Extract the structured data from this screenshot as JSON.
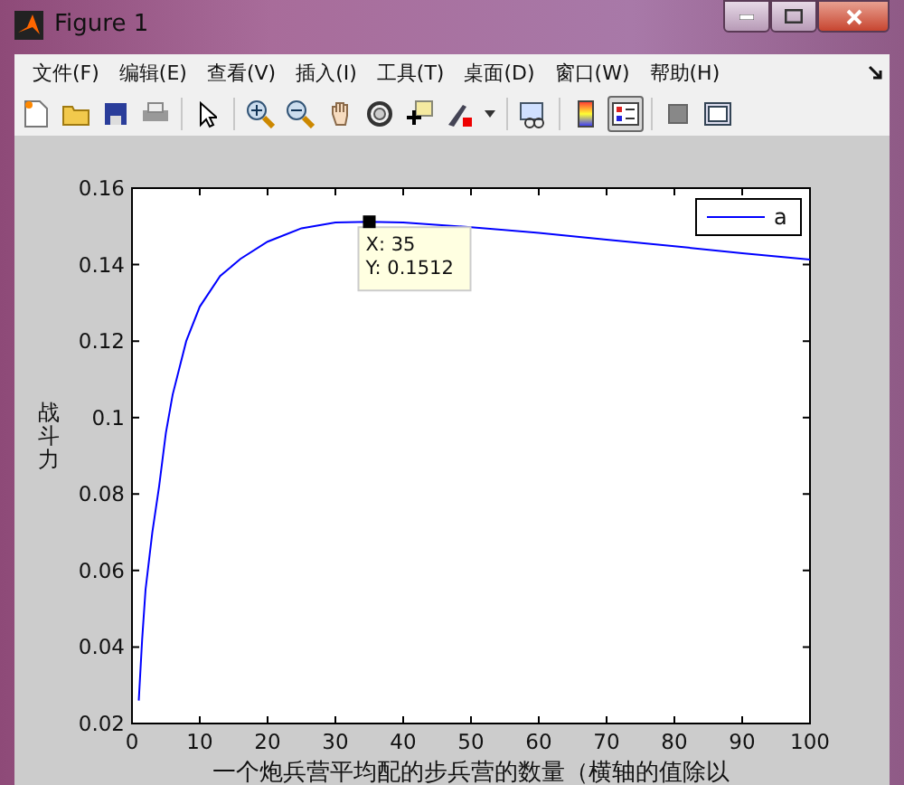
{
  "window": {
    "title": "Figure 1"
  },
  "menu": [
    "文件(F)",
    "编辑(E)",
    "查看(V)",
    "插入(I)",
    "工具(T)",
    "桌面(D)",
    "窗口(W)",
    "帮助(H)"
  ],
  "toolbar": [
    {
      "kind": "new",
      "selected": false
    },
    {
      "kind": "open",
      "selected": false
    },
    {
      "kind": "save",
      "selected": false
    },
    {
      "kind": "print",
      "selected": false
    },
    {
      "kind": "separator"
    },
    {
      "kind": "pointer",
      "selected": false
    },
    {
      "kind": "separator"
    },
    {
      "kind": "zoom-in",
      "selected": false
    },
    {
      "kind": "zoom-out",
      "selected": false
    },
    {
      "kind": "pan",
      "selected": false
    },
    {
      "kind": "rotate",
      "selected": false
    },
    {
      "kind": "datacursor",
      "selected": false
    },
    {
      "kind": "brush",
      "selected": false
    },
    {
      "kind": "dropdown",
      "selected": false
    },
    {
      "kind": "separator"
    },
    {
      "kind": "link",
      "selected": false
    },
    {
      "kind": "separator"
    },
    {
      "kind": "colorbar",
      "selected": false
    },
    {
      "kind": "legend",
      "selected": true
    },
    {
      "kind": "separator"
    },
    {
      "kind": "hide",
      "selected": false
    },
    {
      "kind": "dock",
      "selected": false
    }
  ],
  "chart_data": {
    "type": "line",
    "xlabel": "一个炮兵营平均配的步兵营的数量（横轴的值除以",
    "ylabel": "战斗力",
    "xlim": [
      0,
      100
    ],
    "ylim": [
      0.02,
      0.16
    ],
    "xticks": [
      0,
      10,
      20,
      30,
      40,
      50,
      60,
      70,
      80,
      90,
      100
    ],
    "yticks": [
      {
        "value": 0.02,
        "label": "0.02"
      },
      {
        "value": 0.04,
        "label": "0.04"
      },
      {
        "value": 0.06,
        "label": "0.06"
      },
      {
        "value": 0.08,
        "label": "0.08"
      },
      {
        "value": 0.1,
        "label": "0.1"
      },
      {
        "value": 0.12,
        "label": "0.12"
      },
      {
        "value": 0.14,
        "label": "0.14"
      },
      {
        "value": 0.16,
        "label": "0.16"
      }
    ],
    "x": [
      1,
      1.5,
      2,
      3,
      4,
      5,
      6,
      8,
      10,
      13,
      16,
      20,
      25,
      30,
      35,
      40,
      50,
      60,
      70,
      80,
      90,
      100
    ],
    "series": [
      {
        "name": "a",
        "color": "#0000ff",
        "values": [
          0.026,
          0.042,
          0.055,
          0.07,
          0.082,
          0.096,
          0.106,
          0.12,
          0.129,
          0.137,
          0.1415,
          0.146,
          0.1495,
          0.151,
          0.1512,
          0.151,
          0.1498,
          0.1483,
          0.1465,
          0.1448,
          0.143,
          0.1413
        ]
      }
    ]
  },
  "data_tip": {
    "lines": [
      "X: 35",
      "Y: 0.1512"
    ]
  }
}
